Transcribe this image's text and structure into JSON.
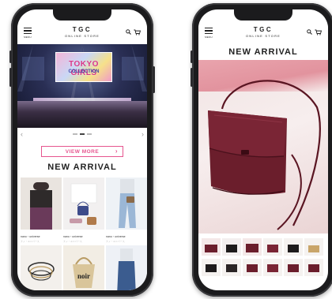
{
  "store": {
    "logo": "TGC",
    "logo_sub": "ONLINE STORE",
    "menu_label": "MENU"
  },
  "left_screen": {
    "hero_banner_text": "TOKYO GIRLS",
    "hero_banner_subtext": "COLLECTION",
    "carousel": {
      "prev": "‹",
      "next": "›",
      "slides": 3,
      "active": 1
    },
    "view_more_label": "VIEW MORE",
    "section_title": "NEW ARRIVAL",
    "products": [
      {
        "brand": "nano・universe",
        "sub": "ナノ・ユニバース",
        "colors": [
          "#efe9e4",
          "#6a3a5a"
        ]
      },
      {
        "brand": "nano・universe",
        "sub": "ナノ・ユニバース",
        "colors": [
          "#f0eeee",
          "#3d4b8a"
        ]
      },
      {
        "brand": "nano・universe",
        "sub": "ナノ・ユニバース",
        "colors": [
          "#e8eef5",
          "#9bb7d6"
        ]
      },
      {
        "brand": "",
        "sub": "",
        "colors": [
          "#f3f0ec",
          "#2b2b2b"
        ]
      },
      {
        "brand": "",
        "sub": "",
        "colors": [
          "#f2ede4",
          "#d9c59a"
        ],
        "print": "noir"
      },
      {
        "brand": "",
        "sub": "",
        "colors": [
          "#eef1f6",
          "#3b5c8f"
        ]
      }
    ]
  },
  "right_screen": {
    "section_title": "NEW ARRIVAL",
    "bag_color": "#6b1e2c",
    "thumbnails": 12
  },
  "colors": {
    "accent": "#e6558f",
    "phone_body": "#1b1b1d",
    "text": "#222222"
  }
}
